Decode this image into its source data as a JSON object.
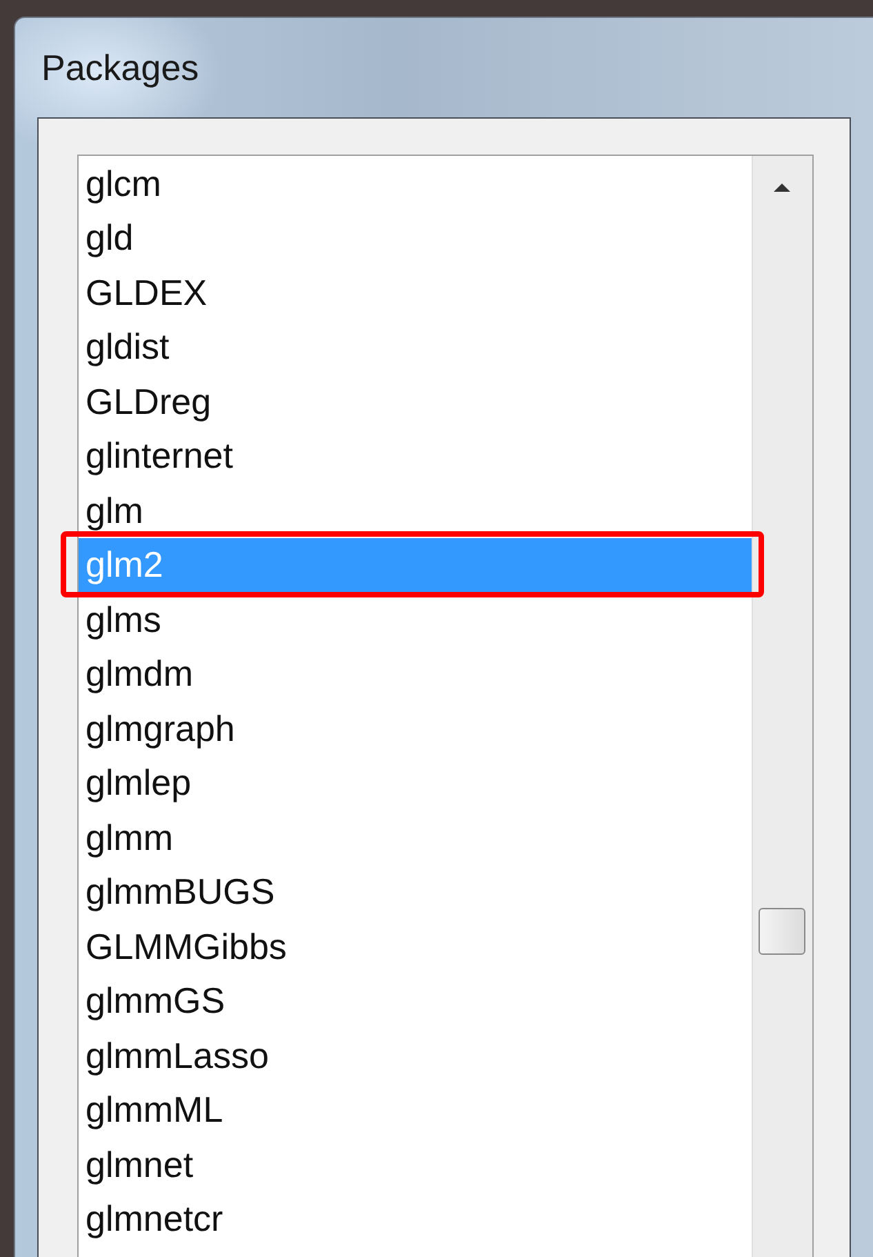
{
  "window": {
    "title": "Packages"
  },
  "packages": [
    {
      "name": "glcm",
      "selected": false
    },
    {
      "name": "gld",
      "selected": false
    },
    {
      "name": "GLDEX",
      "selected": false
    },
    {
      "name": "gldist",
      "selected": false
    },
    {
      "name": "GLDreg",
      "selected": false
    },
    {
      "name": "glinternet",
      "selected": false
    },
    {
      "name": "glm",
      "selected": false
    },
    {
      "name": "glm2",
      "selected": true
    },
    {
      "name": "glms",
      "selected": false
    },
    {
      "name": "glmdm",
      "selected": false
    },
    {
      "name": "glmgraph",
      "selected": false
    },
    {
      "name": "glmlep",
      "selected": false
    },
    {
      "name": "glmm",
      "selected": false
    },
    {
      "name": "glmmBUGS",
      "selected": false
    },
    {
      "name": "GLMMGibbs",
      "selected": false
    },
    {
      "name": "glmmGS",
      "selected": false
    },
    {
      "name": "glmmLasso",
      "selected": false
    },
    {
      "name": "glmmML",
      "selected": false
    },
    {
      "name": "glmnet",
      "selected": false
    },
    {
      "name": "glmnetcr",
      "selected": false
    }
  ]
}
